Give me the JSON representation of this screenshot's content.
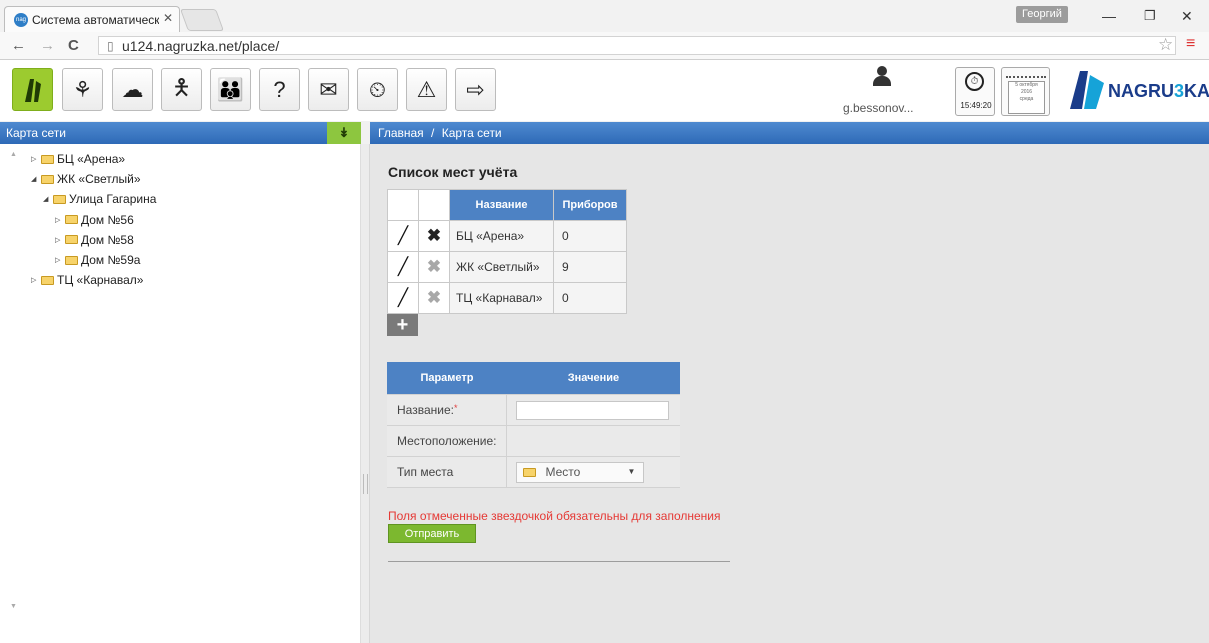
{
  "browser": {
    "tab_title": "Система автоматическог",
    "tab_favicon_text": "nag",
    "user_badge": "Георгий",
    "url": "u124.nagruzka.net/place/"
  },
  "toolbar": {
    "buttons": [
      "network-map",
      "network-tree",
      "cloud-tree",
      "person",
      "group",
      "questions",
      "mail",
      "history",
      "alert",
      "logout"
    ]
  },
  "user": {
    "name": "g.bessonov..."
  },
  "clock": {
    "time": "15:49:20"
  },
  "calendar": {
    "line1": "5 октября",
    "line2": "2016",
    "line3": "среда"
  },
  "logo": {
    "part1": "NAGRU",
    "part2": "3",
    "part3": "KA"
  },
  "sidebar": {
    "title": "Карта сети",
    "tree": [
      {
        "label": "БЦ «Арена»",
        "level": 0,
        "expanded": false
      },
      {
        "label": "ЖК «Светлый»",
        "level": 0,
        "expanded": true
      },
      {
        "label": "Улица Гагарина",
        "level": 1,
        "expanded": true
      },
      {
        "label": "Дом №56",
        "level": 2,
        "expanded": false
      },
      {
        "label": "Дом №58",
        "level": 2,
        "expanded": false
      },
      {
        "label": "Дом №59а",
        "level": 2,
        "expanded": false
      },
      {
        "label": "ТЦ «Карнавал»",
        "level": 0,
        "expanded": false
      }
    ]
  },
  "breadcrumb": {
    "home": "Главная",
    "sep": "/",
    "current": "Карта сети"
  },
  "places": {
    "title": "Список мест учёта",
    "headers": {
      "name": "Название",
      "devices": "Приборов"
    },
    "rows": [
      {
        "name": "БЦ «Арена»",
        "devices": "0",
        "delete_enabled": true
      },
      {
        "name": "ЖК «Светлый»",
        "devices": "9",
        "delete_enabled": false
      },
      {
        "name": "ТЦ «Карнавал»",
        "devices": "0",
        "delete_enabled": false
      }
    ]
  },
  "form": {
    "headers": {
      "param": "Параметр",
      "value": "Значение"
    },
    "name_label": "Название:",
    "required_mark": "*",
    "location_label": "Местоположение:",
    "type_label": "Тип места",
    "type_value": "Место",
    "name_value": "",
    "required_note": "Поля отмеченные звездочкой обязательны для заполнения",
    "submit": "Отправить"
  }
}
